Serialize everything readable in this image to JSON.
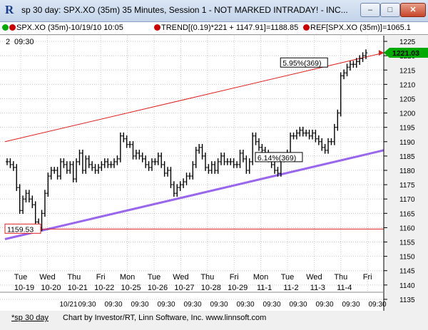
{
  "window": {
    "title": "sp 30 day: SPX.XO (35m) 35 Minutes, Session 1 - NOT MARKED INTRADAY! - INC...",
    "buttons": {
      "minimize": "–",
      "maximize": "□",
      "close": "✕"
    }
  },
  "toolbar": {
    "symbol_label": "SPX.XO (35m)-10/19/10 10:05",
    "trend_label": "TREND[(0.19)*221 + 1147.91]=1188.85",
    "ref_label": "REF[SPX.XO (35m)]=1065.1"
  },
  "subheader": {
    "left_num": "2",
    "time": "09:30"
  },
  "colors": {
    "bars": "#000000",
    "channel_upper": "#e02020",
    "channel_lower": "#9966ee",
    "support": "#e02020",
    "current_price_bg": "#00aa00",
    "chart_bg": "#ffffff",
    "grid": "#c8c8c8"
  },
  "chart_data": {
    "type": "ohlc",
    "y_axis": {
      "min": 1133,
      "max": 1227,
      "ticks": [
        1135,
        1140,
        1145,
        1150,
        1155,
        1160,
        1165,
        1170,
        1175,
        1180,
        1185,
        1190,
        1195,
        1200,
        1205,
        1210,
        1215,
        1220,
        1225
      ],
      "side": "right"
    },
    "days": [
      {
        "dow": "Tue",
        "date": "10-19"
      },
      {
        "dow": "Wed",
        "date": "10-20"
      },
      {
        "dow": "Thu",
        "date": "10-21"
      },
      {
        "dow": "Fri",
        "date": "10-22"
      },
      {
        "dow": "Mon",
        "date": "10-25"
      },
      {
        "dow": "Tue",
        "date": "10-26"
      },
      {
        "dow": "Wed",
        "date": "10-27"
      },
      {
        "dow": "Thu",
        "date": "10-28"
      },
      {
        "dow": "Fri",
        "date": "10-29"
      },
      {
        "dow": "Mon",
        "date": "11-1"
      },
      {
        "dow": "Tue",
        "date": "11-2"
      },
      {
        "dow": "Wed",
        "date": "11-3"
      },
      {
        "dow": "Thu",
        "date": "11-4"
      },
      {
        "dow": "Fri",
        "date": ""
      }
    ],
    "bottom_axis_labels": [
      "10/21",
      "09:30",
      "09:30",
      "09:30",
      "09:30",
      "09:30",
      "09:30",
      "09:30",
      "09:30",
      "09:30",
      "09:30",
      "09:30",
      "09:30"
    ],
    "closes": [
      1183,
      1182,
      1181,
      1174,
      1166,
      1170,
      1172,
      1170,
      1168,
      1162,
      1160,
      1165,
      1172,
      1178,
      1180,
      1180,
      1178,
      1183,
      1182,
      1180,
      1182,
      1177,
      1183,
      1186,
      1180,
      1184,
      1182,
      1181,
      1180,
      1181,
      1182,
      1183,
      1182,
      1182,
      1183,
      1184,
      1192,
      1191,
      1189,
      1189,
      1185,
      1186,
      1185,
      1184,
      1182,
      1181,
      1183,
      1183,
      1185,
      1182,
      1179,
      1180,
      1175,
      1172,
      1174,
      1175,
      1176,
      1178,
      1178,
      1182,
      1187,
      1188,
      1185,
      1181,
      1180,
      1182,
      1180,
      1183,
      1185,
      1183,
      1183,
      1183,
      1182,
      1182,
      1186,
      1184,
      1180,
      1183,
      1192,
      1190,
      1188,
      1187,
      1186,
      1184,
      1182,
      1180,
      1179,
      1184,
      1185,
      1186,
      1192,
      1192,
      1193,
      1194,
      1193,
      1193,
      1192,
      1193,
      1191,
      1190,
      1188,
      1187,
      1190,
      1190,
      1195,
      1200,
      1213,
      1214,
      1216,
      1217,
      1217,
      1218,
      1219,
      1220,
      1221
    ],
    "trend_channel_upper": {
      "from": 1190,
      "to": 1221
    },
    "trend_channel_lower": {
      "from": 1156,
      "to": 1187
    },
    "support_line": {
      "value": 1159.53
    },
    "annotations": [
      {
        "text": "5.95%(369)",
        "value": 1217.5,
        "bar": 100
      },
      {
        "text": "6.14%(369)",
        "value": 1184.5,
        "bar": 92
      }
    ],
    "price_labels": {
      "support": "1159.53",
      "current": "1221.03"
    }
  },
  "footer": {
    "tab": "*sp 30 day",
    "credit": "Chart by Investor/RT, Linn Software, Inc. www.linnsoft.com"
  }
}
